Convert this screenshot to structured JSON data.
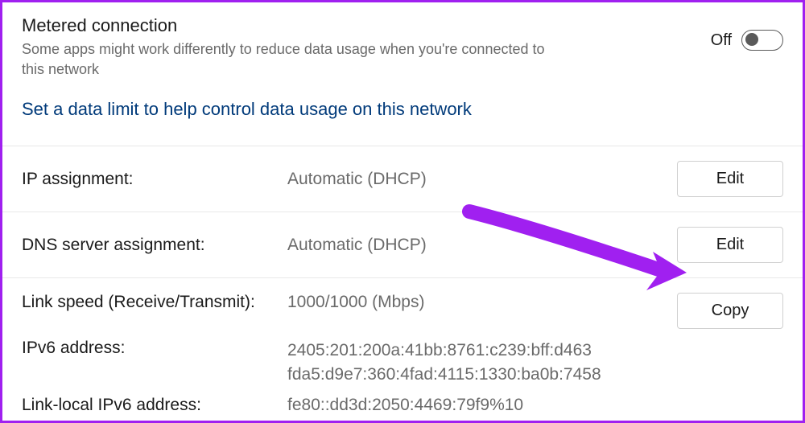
{
  "metered": {
    "title": "Metered connection",
    "description": "Some apps might work differently to reduce data usage when you're connected to this network",
    "toggle_label": "Off",
    "toggle_state": false
  },
  "data_limit_link": "Set a data limit to help control data usage on this network",
  "ip_assignment": {
    "label": "IP assignment:",
    "value": "Automatic (DHCP)",
    "button": "Edit"
  },
  "dns_assignment": {
    "label": "DNS server assignment:",
    "value": "Automatic (DHCP)",
    "button": "Edit"
  },
  "link_speed": {
    "label": "Link speed (Receive/Transmit):",
    "value": "1000/1000 (Mbps)",
    "button": "Copy"
  },
  "ipv6_address": {
    "label": "IPv6 address:",
    "value_line1": "2405:201:200a:41bb:8761:c239:bff:d463",
    "value_line2": "fda5:d9e7:360:4fad:4115:1330:ba0b:7458"
  },
  "link_local_ipv6": {
    "label": "Link-local IPv6 address:",
    "value": "fe80::dd3d:2050:4469:79f9%10"
  },
  "annotation": {
    "arrow_color": "#a020f0"
  }
}
